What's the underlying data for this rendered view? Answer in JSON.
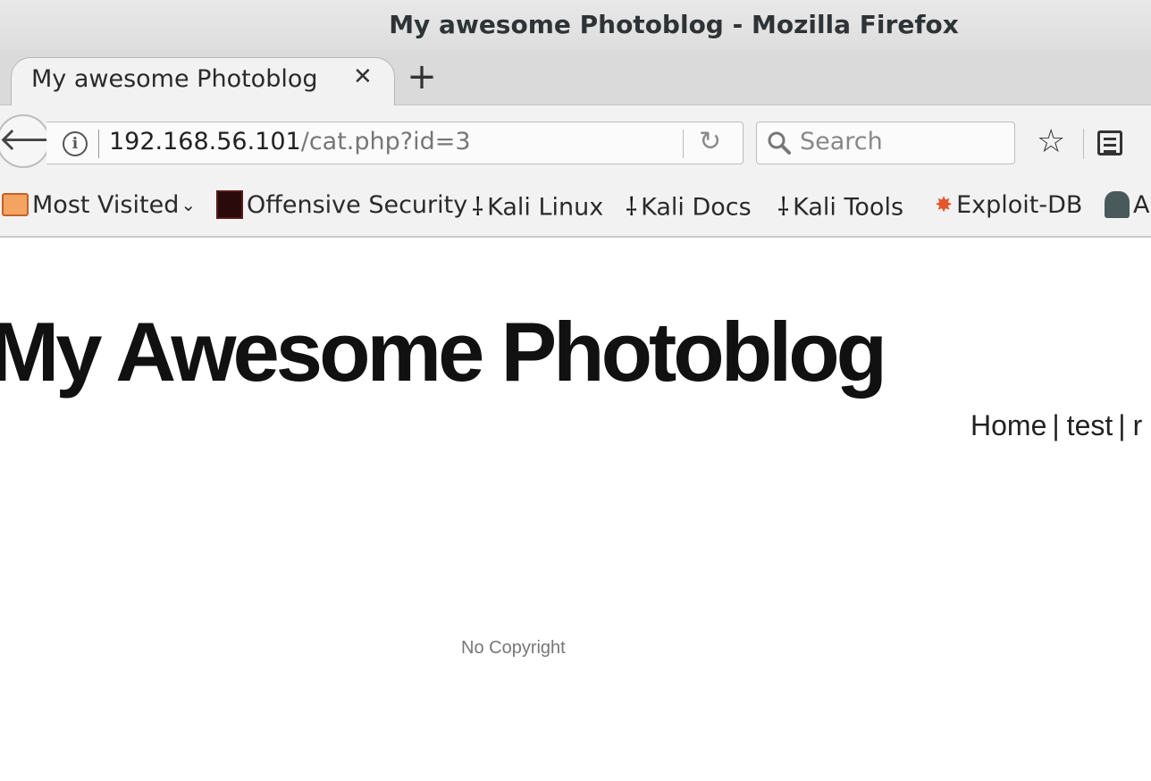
{
  "window": {
    "title": "My awesome Photoblog - Mozilla Firefox"
  },
  "tabs": [
    {
      "label": "My awesome Photoblog",
      "close": "✕"
    }
  ],
  "newtab": {
    "label": "+"
  },
  "urlbar": {
    "host": "192.168.56.101",
    "path": "/cat.php?id=3"
  },
  "searchbar": {
    "placeholder": "Search"
  },
  "bookmarks": [
    {
      "label": "Most Visited",
      "icon": "folder-icon"
    },
    {
      "label": "Offensive Security",
      "icon": "offsec-icon"
    },
    {
      "label": "Kali Linux",
      "icon": "kali-icon"
    },
    {
      "label": "Kali Docs",
      "icon": "kali-icon"
    },
    {
      "label": "Kali Tools",
      "icon": "kali-icon"
    },
    {
      "label": "Exploit-DB",
      "icon": "exploitdb-icon"
    },
    {
      "label": "A",
      "icon": "aircrack-icon"
    }
  ],
  "page": {
    "title": "My Awesome Photoblog",
    "nav": [
      {
        "label": "Home"
      },
      {
        "label": "test"
      },
      {
        "label": "r"
      }
    ],
    "footer": "No Copyright"
  }
}
